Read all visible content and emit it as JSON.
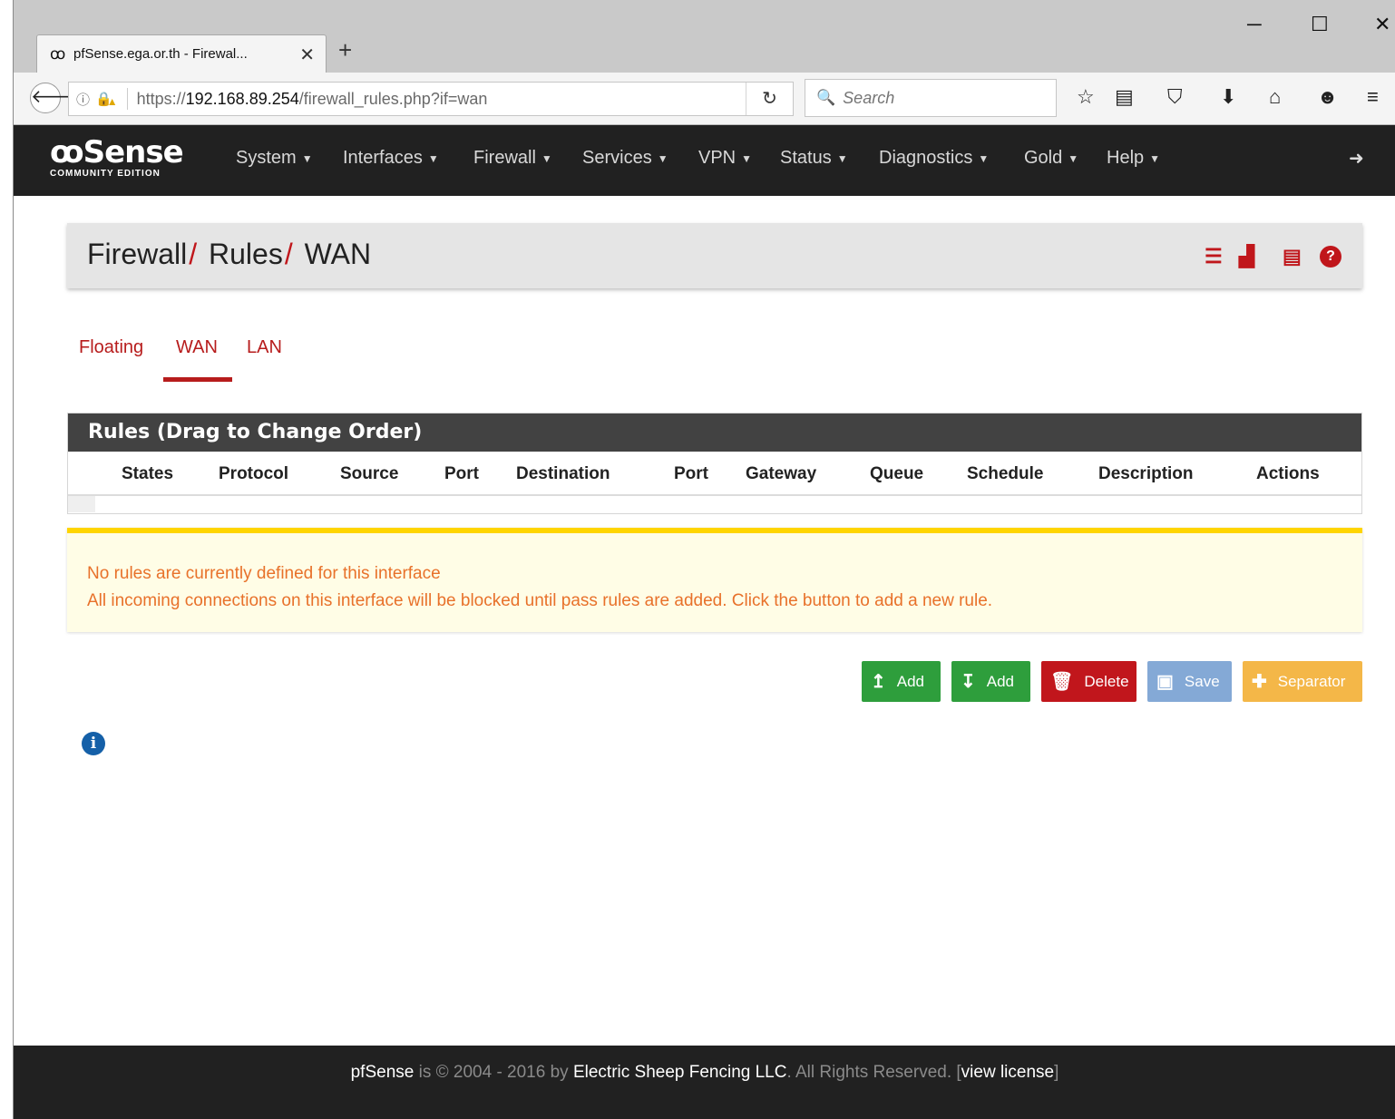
{
  "browser": {
    "tab_title": "pfSense.ega.or.th - Firewal...",
    "url_prefix": "https://",
    "url_host": "192.168.89.254",
    "url_path": "/firewall_rules.php?if=wan",
    "search_placeholder": "Search"
  },
  "nav": {
    "logo_text": "Sense",
    "logo_sub": "COMMUNITY EDITION",
    "menus": [
      "System",
      "Interfaces",
      "Firewall",
      "Services",
      "VPN",
      "Status",
      "Diagnostics",
      "Gold",
      "Help"
    ]
  },
  "breadcrumb": [
    "Firewall",
    "Rules",
    "WAN"
  ],
  "tabs": [
    "Floating",
    "WAN",
    "LAN"
  ],
  "active_tab": "WAN",
  "panel": {
    "title": "Rules (Drag to Change Order)",
    "headers": [
      "States",
      "Protocol",
      "Source",
      "Port",
      "Destination",
      "Port",
      "Gateway",
      "Queue",
      "Schedule",
      "Description",
      "Actions"
    ]
  },
  "alert": {
    "line1": "No rules are currently defined for this interface",
    "line2": "All incoming connections on this interface will be blocked until pass rules are added. Click the button to add a new rule."
  },
  "buttons": {
    "add_top": "Add",
    "add_bottom": "Add",
    "delete": "Delete",
    "save": "Save",
    "separator": "Separator"
  },
  "footer": {
    "brand": "pfSense",
    "is": " is © 2004 - 2016 by ",
    "company": "Electric Sheep Fencing LLC",
    "rights": ". All Rights Reserved. [",
    "license": "view license",
    "close": "]"
  },
  "colors": {
    "accent_red": "#c0161b",
    "nav_bg": "#212121",
    "alert_text": "#e8712a",
    "alert_border": "#ffd500",
    "btn_green": "#2e9e3c",
    "btn_blue": "#84a9d6",
    "btn_orange": "#f4b748"
  }
}
